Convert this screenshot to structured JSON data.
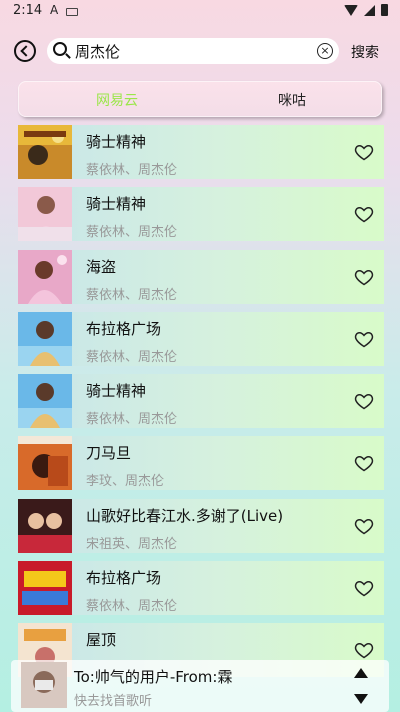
{
  "status_bar": {
    "time": "2:14",
    "notification_icon": "A"
  },
  "header": {
    "search_value": "周杰伦",
    "search_button": "搜索",
    "clear_glyph": "×"
  },
  "tabs": [
    {
      "label": "网易云",
      "active": true
    },
    {
      "label": "咪咕",
      "active": false
    }
  ],
  "songs": [
    {
      "title": "骑士精神",
      "artist": "蔡依林、周杰伦"
    },
    {
      "title": "骑士精神",
      "artist": "蔡依林、周杰伦"
    },
    {
      "title": "海盗",
      "artist": "蔡依林、周杰伦"
    },
    {
      "title": "布拉格广场",
      "artist": "蔡依林、周杰伦"
    },
    {
      "title": "骑士精神",
      "artist": "蔡依林、周杰伦"
    },
    {
      "title": "刀马旦",
      "artist": "李玟、周杰伦"
    },
    {
      "title": "山歌好比春江水.多谢了(Live)",
      "artist": "宋祖英、周杰伦"
    },
    {
      "title": "布拉格广场",
      "artist": "蔡依林、周杰伦"
    },
    {
      "title": "屋顶",
      "artist": ""
    }
  ],
  "player": {
    "title": "To:帅气的用户-From:霖",
    "subtitle": "快去找首歌听"
  },
  "colors": {
    "active_tab": "#9be64a",
    "artist_text": "#999999"
  }
}
